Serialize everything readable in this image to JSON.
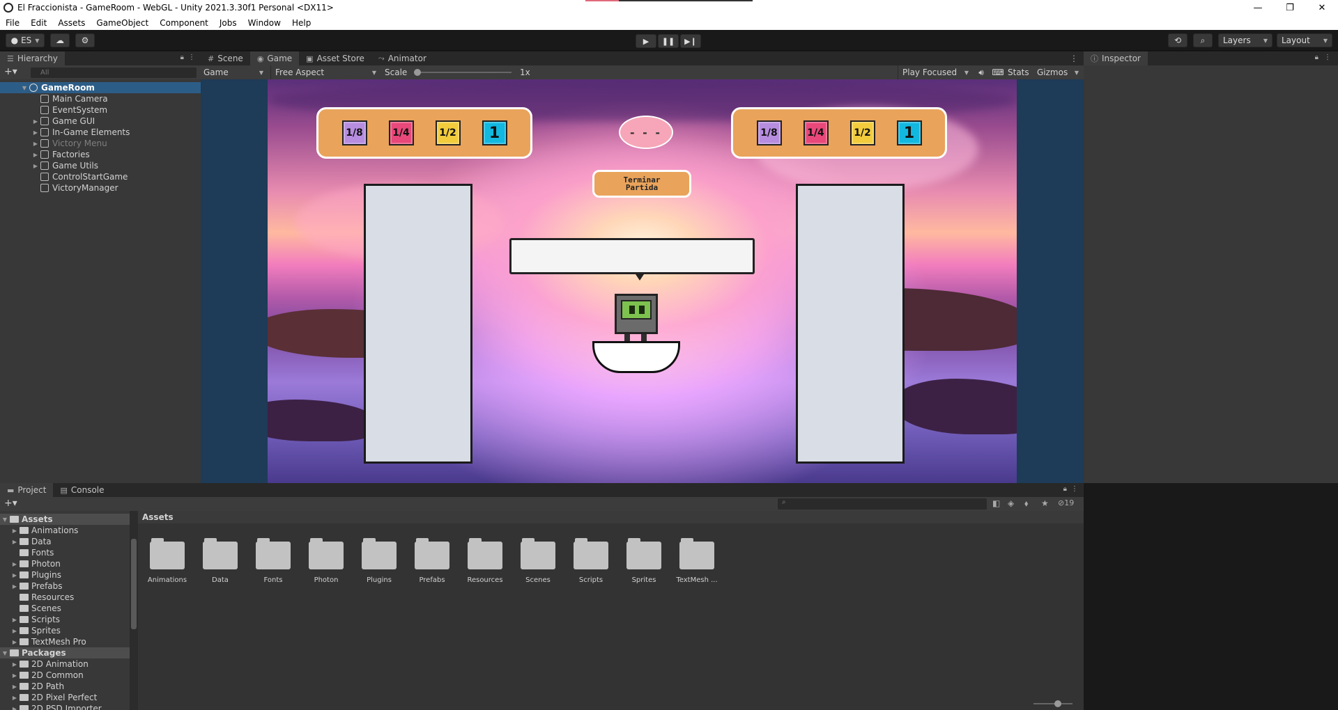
{
  "window": {
    "title": "El Fraccionista - GameRoom - WebGL - Unity 2021.3.30f1 Personal <DX11>",
    "controls": {
      "minimize": "—",
      "restore": "❐",
      "close": "✕"
    }
  },
  "menu": [
    "File",
    "Edit",
    "Assets",
    "GameObject",
    "Component",
    "Jobs",
    "Window",
    "Help"
  ],
  "toolbar": {
    "account": "ES",
    "layers_label": "Layers",
    "layout_label": "Layout"
  },
  "hierarchy": {
    "tab_label": "Hierarchy",
    "search_placeholder": "All",
    "root": "GameRoom",
    "items": [
      {
        "label": "Main Camera",
        "expandable": false,
        "dim": false
      },
      {
        "label": "EventSystem",
        "expandable": false,
        "dim": false
      },
      {
        "label": "Game GUI",
        "expandable": true,
        "dim": false
      },
      {
        "label": "In-Game Elements",
        "expandable": true,
        "dim": false
      },
      {
        "label": "Victory Menu",
        "expandable": true,
        "dim": true
      },
      {
        "label": "Factories",
        "expandable": true,
        "dim": false
      },
      {
        "label": "Game Utils",
        "expandable": true,
        "dim": false
      },
      {
        "label": "ControlStartGame",
        "expandable": false,
        "dim": false
      },
      {
        "label": "VictoryManager",
        "expandable": false,
        "dim": false
      }
    ]
  },
  "game_view": {
    "tabs": [
      "Scene",
      "Game",
      "Asset Store",
      "Animator"
    ],
    "display": "Game",
    "aspect": "Free Aspect",
    "scale_label": "Scale",
    "scale_value": "1x",
    "play_mode": "Play Focused",
    "stats": "Stats",
    "gizmos": "Gizmos"
  },
  "game": {
    "left_fractions": [
      "1/8",
      "1/4",
      "1/2",
      "1"
    ],
    "right_fractions": [
      "1/8",
      "1/4",
      "1/2",
      "1"
    ],
    "fraction_colors": [
      "#b78de0",
      "#e8487a",
      "#f2cc3c",
      "#12b8e0"
    ],
    "oval_text": "- - -",
    "turn_button_lines": [
      "Terminar",
      "Partida"
    ],
    "speech_text": ""
  },
  "inspector": {
    "tab_label": "Inspector"
  },
  "project": {
    "tabs": [
      "Project",
      "Console"
    ],
    "hidden_count": "19",
    "path": "Assets",
    "tree": [
      {
        "label": "Assets",
        "type": "header"
      },
      {
        "label": "Animations",
        "type": "folder",
        "expandable": true
      },
      {
        "label": "Data",
        "type": "folder",
        "expandable": true
      },
      {
        "label": "Fonts",
        "type": "folder",
        "expandable": false
      },
      {
        "label": "Photon",
        "type": "folder",
        "expandable": true
      },
      {
        "label": "Plugins",
        "type": "folder",
        "expandable": true
      },
      {
        "label": "Prefabs",
        "type": "folder",
        "expandable": true
      },
      {
        "label": "Resources",
        "type": "folder",
        "expandable": false
      },
      {
        "label": "Scenes",
        "type": "folder",
        "expandable": false
      },
      {
        "label": "Scripts",
        "type": "folder",
        "expandable": true
      },
      {
        "label": "Sprites",
        "type": "folder",
        "expandable": true
      },
      {
        "label": "TextMesh Pro",
        "type": "folder",
        "expandable": true
      },
      {
        "label": "Packages",
        "type": "header"
      },
      {
        "label": "2D Animation",
        "type": "folder",
        "expandable": true
      },
      {
        "label": "2D Common",
        "type": "folder",
        "expandable": true
      },
      {
        "label": "2D Path",
        "type": "folder",
        "expandable": true
      },
      {
        "label": "2D Pixel Perfect",
        "type": "folder",
        "expandable": true
      },
      {
        "label": "2D PSD Importer",
        "type": "folder",
        "expandable": true
      }
    ],
    "folders": [
      "Animations",
      "Data",
      "Fonts",
      "Photon",
      "Plugins",
      "Prefabs",
      "Resources",
      "Scenes",
      "Scripts",
      "Sprites",
      "TextMesh ..."
    ]
  }
}
